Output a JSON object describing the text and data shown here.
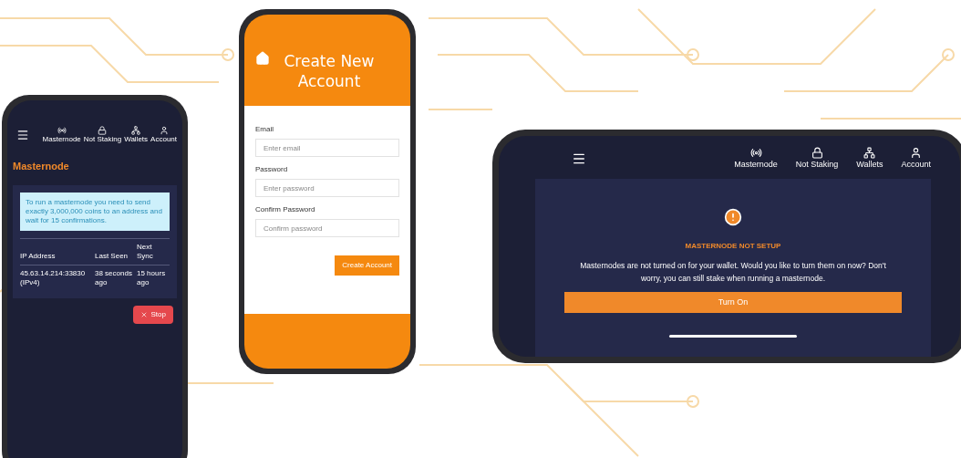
{
  "masternode_phone": {
    "nav": [
      {
        "label": "Masternode"
      },
      {
        "label": "Not Staking"
      },
      {
        "label": "Wallets"
      },
      {
        "label": "Account"
      }
    ],
    "title": "Masternode",
    "notice": "To run a masternode you need to send exactly 3,000,000 coins to an address and wait for 15 confirmations.",
    "columns": [
      "IP Address",
      "Last Seen",
      "Next Sync"
    ],
    "rows": [
      [
        "45.63.14.214:33830 (IPv4)",
        "38 seconds ago",
        "15 hours ago"
      ]
    ],
    "stop_button": "Stop"
  },
  "signup_phone": {
    "title": "Create New Account",
    "fields": [
      {
        "label": "Email",
        "placeholder": "Enter email"
      },
      {
        "label": "Password",
        "placeholder": "Enter password"
      },
      {
        "label": "Confirm Password",
        "placeholder": "Confirm password"
      }
    ],
    "submit_button": "Create Account"
  },
  "setup_phone": {
    "nav": [
      {
        "label": "Masternode"
      },
      {
        "label": "Not Staking"
      },
      {
        "label": "Wallets"
      },
      {
        "label": "Account"
      }
    ],
    "heading": "MASTERNODE NOT SETUP",
    "message": "Masternodes are not turned on for your wallet. Would you like to turn them on now? Don't worry, you can still stake when running a masternode.",
    "turn_on_button": "Turn On"
  }
}
